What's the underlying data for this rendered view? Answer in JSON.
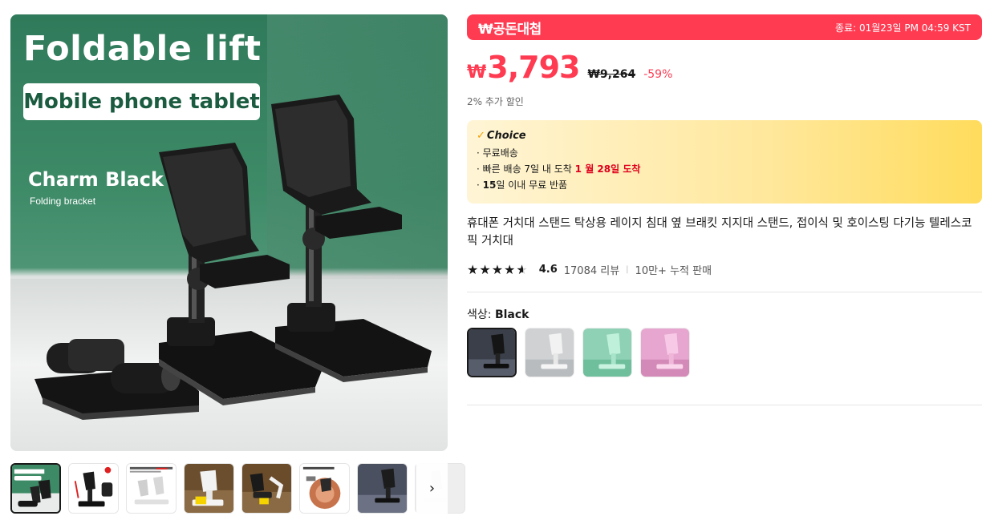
{
  "gallery": {
    "main_image": {
      "headline": "Foldable lift",
      "pill_text": "Mobile phone tablet",
      "color_name": "Charm Black",
      "subtitle": "Folding bracket"
    },
    "thumbnails": [
      {
        "label": "thumb-1",
        "active": true
      },
      {
        "label": "thumb-2",
        "active": false
      },
      {
        "label": "thumb-3",
        "active": false
      },
      {
        "label": "thumb-4",
        "active": false
      },
      {
        "label": "thumb-5",
        "active": false
      },
      {
        "label": "thumb-6",
        "active": false
      },
      {
        "label": "thumb-7",
        "active": false
      },
      {
        "label": "thumb-8",
        "active": false
      }
    ],
    "next_icon": "chevron-right-icon",
    "next_glyph": "›"
  },
  "deal": {
    "logo_text": "₩공돈대첩",
    "ends_text": "종료: 01월23일 PM 04:59 KST",
    "color": "#ff3b52"
  },
  "price": {
    "currency": "₩",
    "current": "3,793",
    "original": "₩9,264",
    "discount": "-59%",
    "extra_discount": "2% 추가 할인"
  },
  "choice": {
    "title": "Choice",
    "check_glyph": "✓",
    "line1": "· 무료배송",
    "line2_prefix": "· 빠른 배송 7일 내 도착 ",
    "line2_highlight": "1 월 28일 도착",
    "line3_bold": "15",
    "line3_rest": "일 이내  무료 반품"
  },
  "product": {
    "title": "휴대폰 거치대 스탠드 탁상용 레이지 침대 옆 브래킷 지지대 스탠드, 접이식 및 호이스팅 다기능 텔레스코픽 거치대"
  },
  "rating": {
    "stars_text": "★★★★★",
    "value": 4.6,
    "score": "4.6",
    "reviews": "17084 리뷰",
    "separator": "|",
    "sold": "10만+ 누적 판매"
  },
  "variants": {
    "label_prefix": "색상: ",
    "selected_name": "Black",
    "options": [
      {
        "name": "Black",
        "color": "#3a3f4a",
        "selected": true
      },
      {
        "name": "White",
        "color": "#cfd1d3",
        "selected": false
      },
      {
        "name": "Green",
        "color": "#8fd1b5",
        "selected": false
      },
      {
        "name": "Pink",
        "color": "#e6a6cf",
        "selected": false
      }
    ]
  }
}
